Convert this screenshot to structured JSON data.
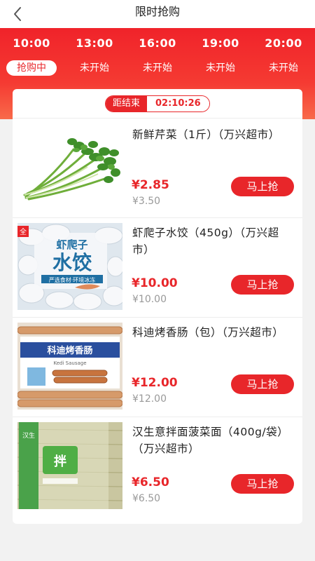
{
  "header": {
    "title": "限时抢购",
    "back_icon": "chevron-left-icon"
  },
  "timeslots": [
    {
      "time": "10:00",
      "status": "抢购中",
      "active": true
    },
    {
      "time": "13:00",
      "status": "未开始",
      "active": false
    },
    {
      "time": "16:00",
      "status": "未开始",
      "active": false
    },
    {
      "time": "19:00",
      "status": "未开始",
      "active": false
    },
    {
      "time": "20:00",
      "status": "未开始",
      "active": false
    }
  ],
  "countdown": {
    "label": "距结束",
    "value": "02:10:26"
  },
  "products": [
    {
      "name": "新鲜芹菜（1斤）（万兴超市）",
      "price": "¥2.85",
      "original_price": "¥3.50",
      "button": "马上抢",
      "image": "celery"
    },
    {
      "name": "虾爬子水饺（450g）（万兴超市）",
      "price": "¥10.00",
      "original_price": "¥10.00",
      "button": "马上抢",
      "image": "dumplings-package",
      "image_text": {
        "brand": "虾爬子",
        "product": "水饺",
        "tagline": "严选食材·环境冰冻",
        "corner": "全"
      }
    },
    {
      "name": "科迪烤香肠（包）（万兴超市）",
      "price": "¥12.00",
      "original_price": "¥12.00",
      "button": "马上抢",
      "image": "sausage-package",
      "image_text": {
        "brand": "科迪烤香肠",
        "english": "Kedi Sausage"
      }
    },
    {
      "name": "汉生意拌面菠菜面（400g/袋）（万兴超市）",
      "price": "¥6.50",
      "original_price": "¥6.50",
      "button": "马上抢",
      "image": "spinach-noodles",
      "image_text": {
        "brand": "汉生",
        "product": "拌"
      }
    }
  ],
  "colors": {
    "accent": "#e8262a",
    "hero_top": "#f0232a",
    "hero_bottom": "#f86a4a"
  }
}
